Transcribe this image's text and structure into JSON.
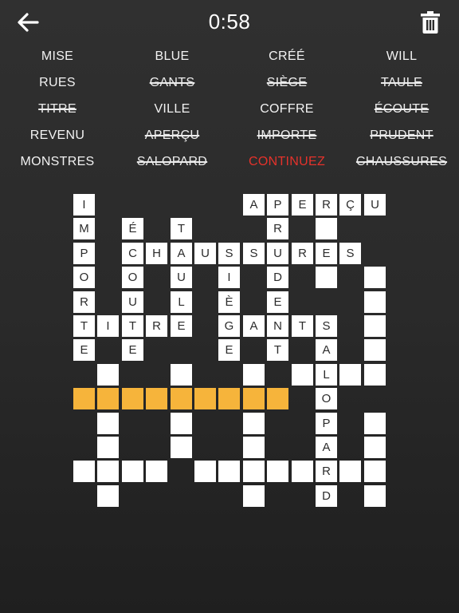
{
  "header": {
    "timer": "0:58",
    "back_icon": "arrow-left-icon",
    "delete_icon": "trash-icon"
  },
  "accent_color": "#f6b43b",
  "word_list": [
    {
      "label": "MISE",
      "found": false,
      "active": false
    },
    {
      "label": "BLUE",
      "found": false,
      "active": false
    },
    {
      "label": "CRÉÉ",
      "found": false,
      "active": false
    },
    {
      "label": "WILL",
      "found": false,
      "active": false
    },
    {
      "label": "RUES",
      "found": false,
      "active": false
    },
    {
      "label": "GANTS",
      "found": true,
      "active": false
    },
    {
      "label": "SIÈGE",
      "found": true,
      "active": false
    },
    {
      "label": "TAULE",
      "found": true,
      "active": false
    },
    {
      "label": "TITRE",
      "found": true,
      "active": false
    },
    {
      "label": "VILLE",
      "found": false,
      "active": false
    },
    {
      "label": "COFFRE",
      "found": false,
      "active": false
    },
    {
      "label": "ÉCOUTE",
      "found": true,
      "active": false
    },
    {
      "label": "REVENU",
      "found": false,
      "active": false
    },
    {
      "label": "APERÇU",
      "found": true,
      "active": false
    },
    {
      "label": "IMPORTE",
      "found": true,
      "active": false
    },
    {
      "label": "PRUDENT",
      "found": true,
      "active": false
    },
    {
      "label": "MONSTRES",
      "found": false,
      "active": false
    },
    {
      "label": "SALOPARD",
      "found": true,
      "active": false
    },
    {
      "label": "CONTINUEZ",
      "found": false,
      "active": true
    },
    {
      "label": "CHAUSSURES",
      "found": true,
      "active": false
    }
  ],
  "grid": {
    "cols": 13,
    "rows": 13,
    "cells": [
      {
        "r": 0,
        "c": 0,
        "letter": "I"
      },
      {
        "r": 0,
        "c": 7,
        "letter": "A"
      },
      {
        "r": 0,
        "c": 8,
        "letter": "P"
      },
      {
        "r": 0,
        "c": 9,
        "letter": "E"
      },
      {
        "r": 0,
        "c": 10,
        "letter": "R"
      },
      {
        "r": 0,
        "c": 11,
        "letter": "Ç"
      },
      {
        "r": 0,
        "c": 12,
        "letter": "U"
      },
      {
        "r": 1,
        "c": 0,
        "letter": "M"
      },
      {
        "r": 1,
        "c": 2,
        "letter": "É"
      },
      {
        "r": 1,
        "c": 4,
        "letter": "T"
      },
      {
        "r": 1,
        "c": 8,
        "letter": "R"
      },
      {
        "r": 1,
        "c": 10,
        "letter": ""
      },
      {
        "r": 2,
        "c": 0,
        "letter": "P"
      },
      {
        "r": 2,
        "c": 2,
        "letter": "C"
      },
      {
        "r": 2,
        "c": 3,
        "letter": "H"
      },
      {
        "r": 2,
        "c": 4,
        "letter": "A"
      },
      {
        "r": 2,
        "c": 5,
        "letter": "U"
      },
      {
        "r": 2,
        "c": 6,
        "letter": "S"
      },
      {
        "r": 2,
        "c": 7,
        "letter": "S"
      },
      {
        "r": 2,
        "c": 8,
        "letter": "U"
      },
      {
        "r": 2,
        "c": 9,
        "letter": "R"
      },
      {
        "r": 2,
        "c": 10,
        "letter": "E"
      },
      {
        "r": 2,
        "c": 11,
        "letter": "S"
      },
      {
        "r": 3,
        "c": 0,
        "letter": "O"
      },
      {
        "r": 3,
        "c": 2,
        "letter": "O"
      },
      {
        "r": 3,
        "c": 4,
        "letter": "U"
      },
      {
        "r": 3,
        "c": 6,
        "letter": "I"
      },
      {
        "r": 3,
        "c": 8,
        "letter": "D"
      },
      {
        "r": 3,
        "c": 10,
        "letter": ""
      },
      {
        "r": 3,
        "c": 12,
        "letter": ""
      },
      {
        "r": 4,
        "c": 0,
        "letter": "R"
      },
      {
        "r": 4,
        "c": 2,
        "letter": "U"
      },
      {
        "r": 4,
        "c": 4,
        "letter": "L"
      },
      {
        "r": 4,
        "c": 6,
        "letter": "È"
      },
      {
        "r": 4,
        "c": 8,
        "letter": "E"
      },
      {
        "r": 4,
        "c": 12,
        "letter": ""
      },
      {
        "r": 5,
        "c": 0,
        "letter": "T"
      },
      {
        "r": 5,
        "c": 1,
        "letter": "I"
      },
      {
        "r": 5,
        "c": 2,
        "letter": "T"
      },
      {
        "r": 5,
        "c": 3,
        "letter": "R"
      },
      {
        "r": 5,
        "c": 4,
        "letter": "E"
      },
      {
        "r": 5,
        "c": 6,
        "letter": "G"
      },
      {
        "r": 5,
        "c": 7,
        "letter": "A"
      },
      {
        "r": 5,
        "c": 8,
        "letter": "N"
      },
      {
        "r": 5,
        "c": 9,
        "letter": "T"
      },
      {
        "r": 5,
        "c": 10,
        "letter": "S"
      },
      {
        "r": 5,
        "c": 12,
        "letter": ""
      },
      {
        "r": 6,
        "c": 0,
        "letter": "E"
      },
      {
        "r": 6,
        "c": 2,
        "letter": "E"
      },
      {
        "r": 6,
        "c": 6,
        "letter": "E"
      },
      {
        "r": 6,
        "c": 8,
        "letter": "T"
      },
      {
        "r": 6,
        "c": 10,
        "letter": "A"
      },
      {
        "r": 6,
        "c": 12,
        "letter": ""
      },
      {
        "r": 7,
        "c": 1,
        "letter": ""
      },
      {
        "r": 7,
        "c": 4,
        "letter": ""
      },
      {
        "r": 7,
        "c": 7,
        "letter": ""
      },
      {
        "r": 7,
        "c": 9,
        "letter": ""
      },
      {
        "r": 7,
        "c": 10,
        "letter": "L"
      },
      {
        "r": 7,
        "c": 11,
        "letter": ""
      },
      {
        "r": 7,
        "c": 12,
        "letter": ""
      },
      {
        "r": 8,
        "c": 0,
        "letter": "",
        "hl": true
      },
      {
        "r": 8,
        "c": 1,
        "letter": "",
        "hl": true
      },
      {
        "r": 8,
        "c": 2,
        "letter": "",
        "hl": true
      },
      {
        "r": 8,
        "c": 3,
        "letter": "",
        "hl": true
      },
      {
        "r": 8,
        "c": 4,
        "letter": "",
        "hl": true
      },
      {
        "r": 8,
        "c": 5,
        "letter": "",
        "hl": true
      },
      {
        "r": 8,
        "c": 6,
        "letter": "",
        "hl": true
      },
      {
        "r": 8,
        "c": 7,
        "letter": "",
        "hl": true
      },
      {
        "r": 8,
        "c": 8,
        "letter": "",
        "hl": true
      },
      {
        "r": 8,
        "c": 10,
        "letter": "O"
      },
      {
        "r": 9,
        "c": 1,
        "letter": ""
      },
      {
        "r": 9,
        "c": 4,
        "letter": ""
      },
      {
        "r": 9,
        "c": 7,
        "letter": ""
      },
      {
        "r": 9,
        "c": 10,
        "letter": "P"
      },
      {
        "r": 9,
        "c": 12,
        "letter": ""
      },
      {
        "r": 10,
        "c": 1,
        "letter": ""
      },
      {
        "r": 10,
        "c": 4,
        "letter": ""
      },
      {
        "r": 10,
        "c": 7,
        "letter": ""
      },
      {
        "r": 10,
        "c": 10,
        "letter": "A"
      },
      {
        "r": 10,
        "c": 12,
        "letter": ""
      },
      {
        "r": 11,
        "c": 0,
        "letter": ""
      },
      {
        "r": 11,
        "c": 1,
        "letter": ""
      },
      {
        "r": 11,
        "c": 2,
        "letter": ""
      },
      {
        "r": 11,
        "c": 3,
        "letter": ""
      },
      {
        "r": 11,
        "c": 5,
        "letter": ""
      },
      {
        "r": 11,
        "c": 6,
        "letter": ""
      },
      {
        "r": 11,
        "c": 7,
        "letter": ""
      },
      {
        "r": 11,
        "c": 8,
        "letter": ""
      },
      {
        "r": 11,
        "c": 9,
        "letter": ""
      },
      {
        "r": 11,
        "c": 10,
        "letter": "R"
      },
      {
        "r": 11,
        "c": 11,
        "letter": ""
      },
      {
        "r": 11,
        "c": 12,
        "letter": ""
      },
      {
        "r": 12,
        "c": 1,
        "letter": ""
      },
      {
        "r": 12,
        "c": 7,
        "letter": ""
      },
      {
        "r": 12,
        "c": 10,
        "letter": "D"
      },
      {
        "r": 12,
        "c": 12,
        "letter": ""
      }
    ]
  }
}
